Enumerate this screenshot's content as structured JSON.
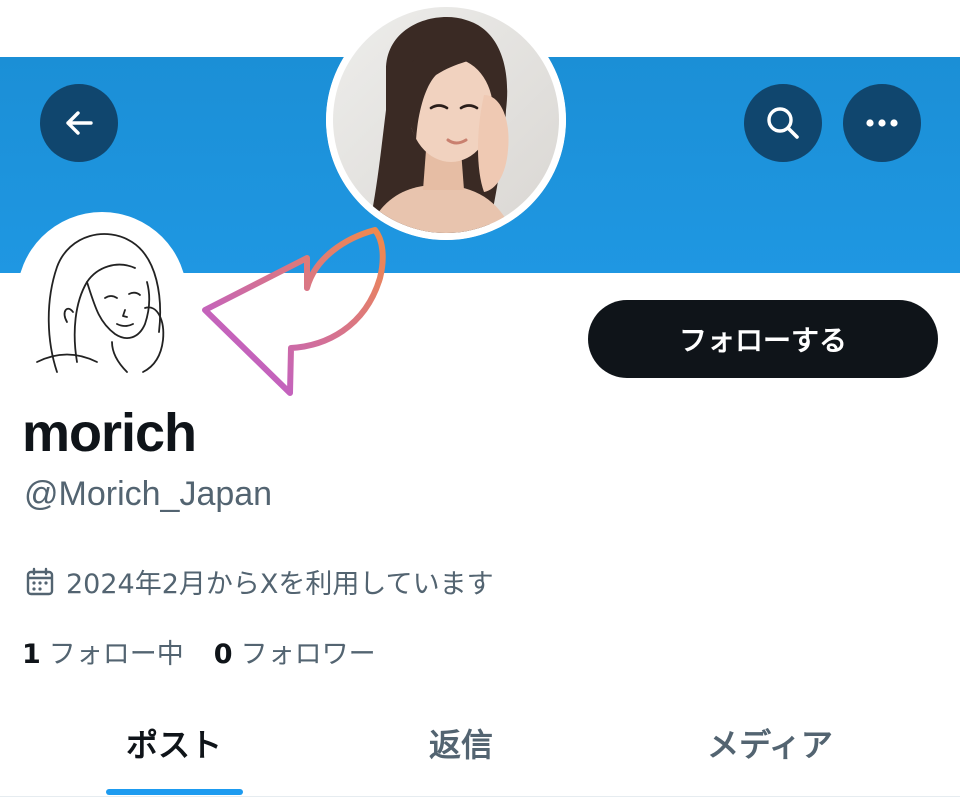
{
  "header": {
    "back_icon": "arrow-left-icon",
    "search_icon": "search-icon",
    "more_icon": "more-horizontal-icon",
    "banner_color": "#1d93dd",
    "button_color": "#10466e"
  },
  "profile": {
    "display_name": "morich",
    "handle": "@Morich_Japan",
    "joined": "2024年2月からXを利用しています",
    "following_count": "1",
    "following_label": "フォロー中",
    "followers_count": "0",
    "followers_label": "フォロワー"
  },
  "actions": {
    "follow_label": "フォローする"
  },
  "tabs": [
    {
      "label": "ポスト",
      "active": true
    },
    {
      "label": "返信",
      "active": false
    },
    {
      "label": "メディア",
      "active": false
    }
  ],
  "colors": {
    "accent": "#1d9bf0",
    "text_primary": "#0f1419",
    "text_secondary": "#536471",
    "arrow_gradient_start": "#f08a4b",
    "arrow_gradient_end": "#b656e0"
  }
}
